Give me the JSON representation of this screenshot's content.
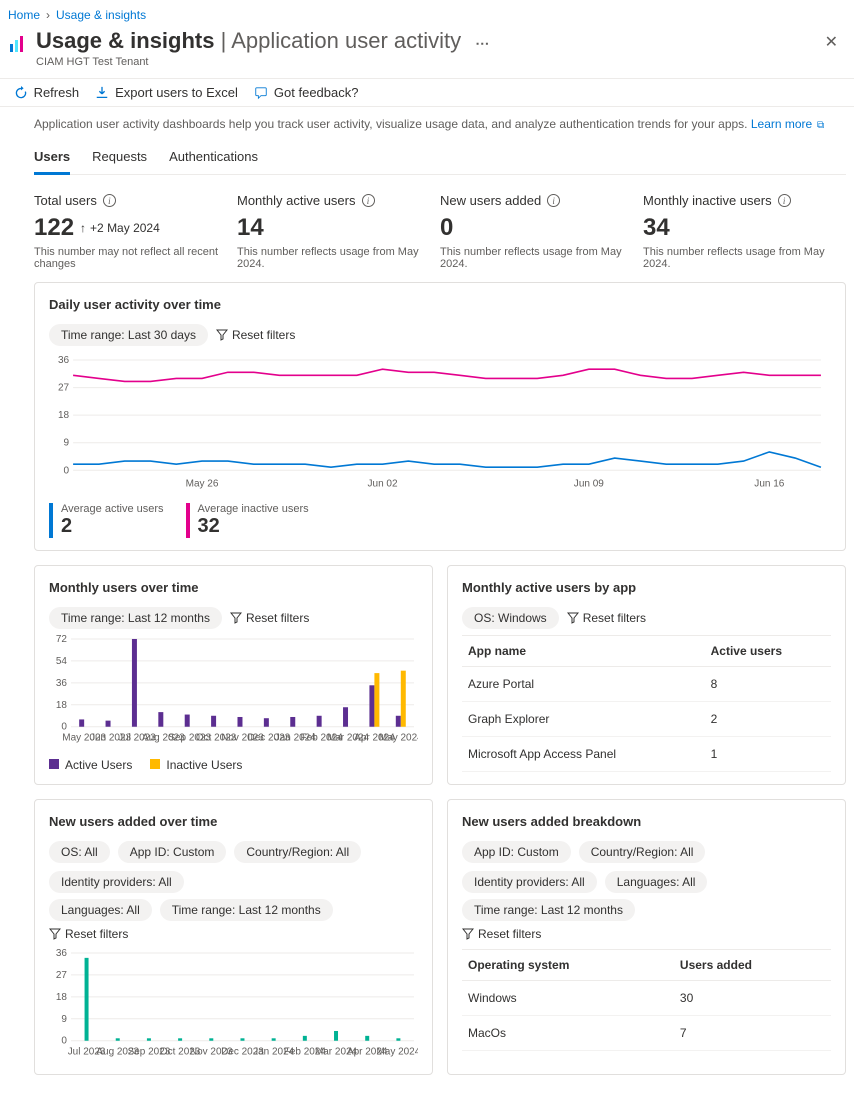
{
  "breadcrumb": {
    "home": "Home",
    "current": "Usage & insights"
  },
  "header": {
    "title_main": "Usage & insights",
    "title_sub": "Application user activity",
    "tenant": "CIAM HGT Test Tenant"
  },
  "toolbar": {
    "refresh": "Refresh",
    "export": "Export users to Excel",
    "feedback": "Got feedback?"
  },
  "description": {
    "text": "Application user activity dashboards help you track user activity, visualize usage data, and analyze authentication trends for your apps.",
    "learn": "Learn more"
  },
  "tabs": {
    "users": "Users",
    "requests": "Requests",
    "auth": "Authentications"
  },
  "metrics": {
    "total": {
      "label": "Total users",
      "value": "122",
      "delta": "+2 May 2024",
      "note": "This number may not reflect all recent changes"
    },
    "mau": {
      "label": "Monthly active users",
      "value": "14",
      "note": "This number reflects usage from May 2024."
    },
    "new": {
      "label": "New users added",
      "value": "0",
      "note": "This number reflects usage from May 2024."
    },
    "inactive": {
      "label": "Monthly inactive users",
      "value": "34",
      "note": "This number reflects usage from May 2024."
    }
  },
  "daily_card": {
    "title": "Daily user activity over time",
    "range_pill": "Time range: Last 30 days",
    "reset": "Reset filters",
    "avg_active_lbl": "Average active users",
    "avg_active_val": "2",
    "avg_inactive_lbl": "Average inactive users",
    "avg_inactive_val": "32"
  },
  "monthly_card": {
    "title": "Monthly users over time",
    "range_pill": "Time range: Last 12 months",
    "reset": "Reset filters",
    "legend_active": "Active Users",
    "legend_inactive": "Inactive Users"
  },
  "byapp_card": {
    "title": "Monthly active users by app",
    "os_pill": "OS: Windows",
    "reset": "Reset filters",
    "col_app": "App name",
    "col_users": "Active users",
    "rows": [
      {
        "app": "Azure Portal",
        "users": "8"
      },
      {
        "app": "Graph Explorer",
        "users": "2"
      },
      {
        "app": "Microsoft App Access Panel",
        "users": "1"
      }
    ]
  },
  "newusers_card": {
    "title": "New users added over time",
    "pills": {
      "os": "OS: All",
      "app": "App ID: Custom",
      "country": "Country/Region: All",
      "idp": "Identity providers: All",
      "lang": "Languages: All",
      "time": "Time range: Last 12 months"
    },
    "reset": "Reset filters"
  },
  "breakdown_card": {
    "title": "New users added breakdown",
    "pills": {
      "app": "App ID: Custom",
      "country": "Country/Region: All",
      "idp": "Identity providers: All",
      "lang": "Languages: All",
      "time": "Time range: Last 12 months"
    },
    "reset": "Reset filters",
    "col_os": "Operating system",
    "col_users": "Users added",
    "rows": [
      {
        "os": "Windows",
        "users": "30"
      },
      {
        "os": "MacOs",
        "users": "7"
      }
    ]
  },
  "chart_data": [
    {
      "id": "daily_activity",
      "type": "line",
      "x_categories": [
        "May 26",
        "Jun 02",
        "Jun 09",
        "Jun 16"
      ],
      "y_ticks": [
        0,
        9,
        18,
        27,
        36
      ],
      "ylim": [
        0,
        36
      ],
      "series": [
        {
          "name": "Inactive users",
          "color": "#e3008c",
          "values": [
            31,
            30,
            29,
            29,
            30,
            30,
            32,
            32,
            31,
            31,
            31,
            31,
            33,
            32,
            32,
            31,
            30,
            30,
            30,
            31,
            33,
            33,
            31,
            30,
            30,
            31,
            32,
            31,
            31,
            31
          ]
        },
        {
          "name": "Active users",
          "color": "#0078d4",
          "values": [
            2,
            2,
            3,
            3,
            2,
            3,
            3,
            2,
            2,
            2,
            1,
            2,
            2,
            3,
            2,
            2,
            1,
            1,
            1,
            2,
            2,
            4,
            3,
            2,
            2,
            2,
            3,
            6,
            4,
            1
          ]
        }
      ]
    },
    {
      "id": "monthly_users",
      "type": "bar",
      "categories": [
        "May 2023",
        "Jun 2023",
        "Jul 2023",
        "Aug 2023",
        "Sep 2023",
        "Oct 2023",
        "Nov 2023",
        "Dec 2023",
        "Jan 2024",
        "Feb 2024",
        "Mar 2024",
        "Apr 2024",
        "May 2024"
      ],
      "y_ticks": [
        0,
        18,
        36,
        54,
        72
      ],
      "ylim": [
        0,
        72
      ],
      "series": [
        {
          "name": "Active Users",
          "color": "#5c2e91",
          "values": [
            6,
            5,
            72,
            12,
            10,
            9,
            8,
            7,
            8,
            9,
            16,
            34,
            9
          ]
        },
        {
          "name": "Inactive Users",
          "color": "#ffb900",
          "values": [
            0,
            0,
            0,
            0,
            0,
            0,
            0,
            0,
            0,
            0,
            0,
            44,
            46
          ]
        }
      ]
    },
    {
      "id": "new_users_over_time",
      "type": "bar",
      "categories": [
        "Jul 2023",
        "Aug 2023",
        "Sep 2023",
        "Oct 2023",
        "Nov 2023",
        "Dec 2023",
        "Jan 2024",
        "Feb 2024",
        "Mar 2024",
        "Apr 2024",
        "May 2024"
      ],
      "y_ticks": [
        0,
        9,
        18,
        27,
        36
      ],
      "ylim": [
        0,
        36
      ],
      "series": [
        {
          "name": "New users",
          "color": "#00b294",
          "values": [
            34,
            1,
            1,
            1,
            1,
            1,
            1,
            2,
            4,
            2,
            1
          ]
        }
      ]
    }
  ]
}
